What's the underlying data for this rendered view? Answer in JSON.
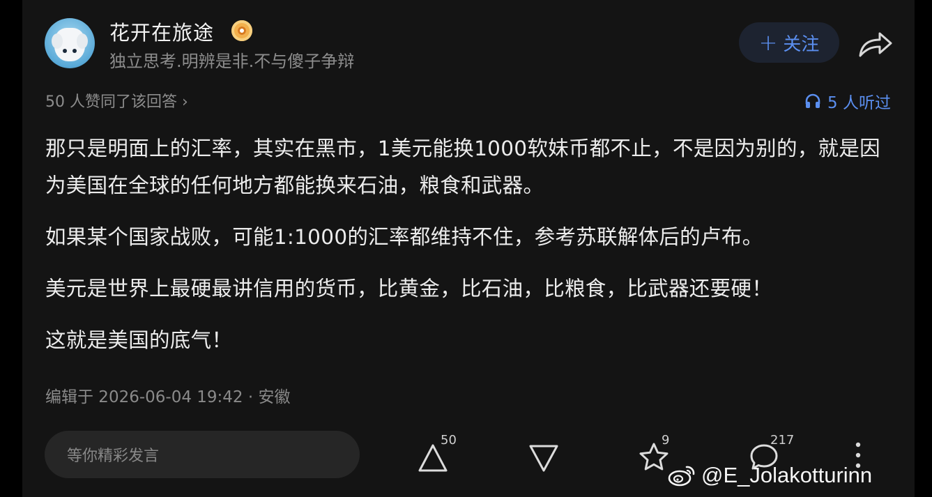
{
  "author": {
    "name": "花开在旅途",
    "bio": "独立思考.明辨是非.不与傻子争辩",
    "avatar_icon": "cartoon-dog-avatar",
    "badge_icon": "orange-eye-badge-icon"
  },
  "header": {
    "follow_label": "关注",
    "follow_icon": "plus-icon",
    "share_icon": "share-arrow-icon"
  },
  "meta": {
    "upvote_summary": "50 人赞同了该回答 ›",
    "listen_label": "5 人听过",
    "listen_icon": "headphones-icon"
  },
  "answer": {
    "paragraphs": [
      "那只是明面上的汇率，其实在黑市，1美元能换1000软妹币都不止，不是因为别的，就是因为美国在全球的任何地方都能换来石油，粮食和武器。",
      "如果某个国家战败，可能1:1000的汇率都维持不住，参考苏联解体后的卢布。",
      "美元是世界上最硬最讲信用的货币，比黄金，比石油，比粮食，比武器还要硬！",
      "这就是美国的底气！"
    ],
    "edit_info": "编辑于 2026-06-04 19:42 · 安徽"
  },
  "actions": {
    "comment_placeholder": "等你精彩发言",
    "upvote_count": "50",
    "favorite_count": "9",
    "comment_count": "217"
  },
  "watermark": {
    "text": "@E_Jolakotturinn",
    "icon": "weibo-logo-icon"
  },
  "colors": {
    "background": "#141414",
    "accent": "#5b8ff0",
    "muted_text": "#8d8d8d"
  }
}
